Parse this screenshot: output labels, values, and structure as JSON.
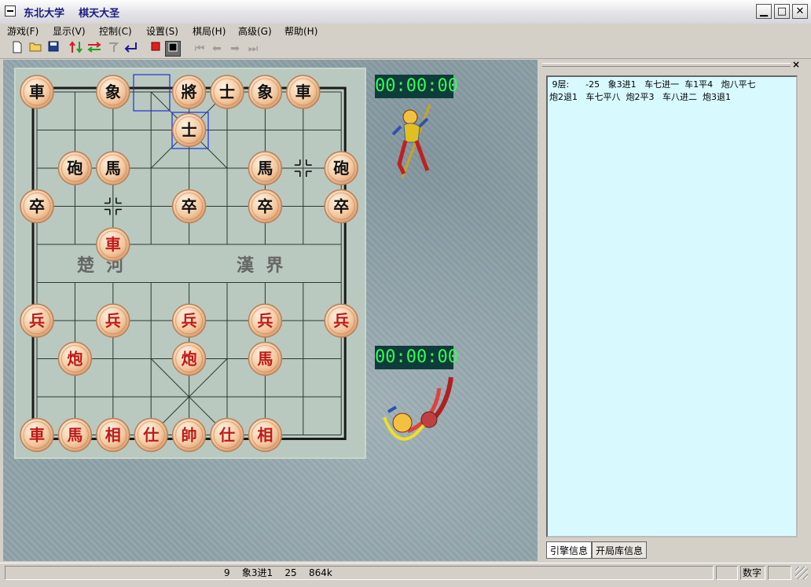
{
  "window": {
    "title": "东北大学    棋天大圣"
  },
  "menu": [
    "游戏(F)",
    "显示(V)",
    "控制(C)",
    "设置(S)",
    "棋局(H)",
    "高级(G)",
    "帮助(H)"
  ],
  "board": {
    "river_left": "楚  河",
    "river_right": "漢  界",
    "black_pieces": [
      {
        "label": "車",
        "col": 0,
        "row": 0
      },
      {
        "label": "象",
        "col": 2,
        "row": 0
      },
      {
        "label": "將",
        "col": 4,
        "row": 0
      },
      {
        "label": "士",
        "col": 5,
        "row": 0
      },
      {
        "label": "象",
        "col": 6,
        "row": 0
      },
      {
        "label": "車",
        "col": 7,
        "row": 0
      },
      {
        "label": "士",
        "col": 4,
        "row": 1
      },
      {
        "label": "砲",
        "col": 1,
        "row": 2
      },
      {
        "label": "馬",
        "col": 2,
        "row": 2
      },
      {
        "label": "馬",
        "col": 6,
        "row": 2
      },
      {
        "label": "砲",
        "col": 8,
        "row": 2
      },
      {
        "label": "卒",
        "col": 0,
        "row": 3
      },
      {
        "label": "卒",
        "col": 4,
        "row": 3
      },
      {
        "label": "卒",
        "col": 6,
        "row": 3
      },
      {
        "label": "卒",
        "col": 8,
        "row": 3
      }
    ],
    "red_pieces": [
      {
        "label": "車",
        "col": 2,
        "row": 4
      },
      {
        "label": "兵",
        "col": 0,
        "row": 6
      },
      {
        "label": "兵",
        "col": 2,
        "row": 6
      },
      {
        "label": "兵",
        "col": 4,
        "row": 6
      },
      {
        "label": "兵",
        "col": 6,
        "row": 6
      },
      {
        "label": "兵",
        "col": 8,
        "row": 6
      },
      {
        "label": "炮",
        "col": 1,
        "row": 7
      },
      {
        "label": "炮",
        "col": 4,
        "row": 7
      },
      {
        "label": "馬",
        "col": 6,
        "row": 7
      },
      {
        "label": "車",
        "col": 0,
        "row": 9
      },
      {
        "label": "馬",
        "col": 1,
        "row": 9
      },
      {
        "label": "相",
        "col": 2,
        "row": 9
      },
      {
        "label": "仕",
        "col": 3,
        "row": 9
      },
      {
        "label": "帥",
        "col": 4,
        "row": 9
      },
      {
        "label": "仕",
        "col": 5,
        "row": 9
      },
      {
        "label": "相",
        "col": 6,
        "row": 9
      }
    ]
  },
  "clocks": {
    "top": "00:00:00",
    "bottom": "00:00:00"
  },
  "engine_info": {
    "line1": " 9层:      -25   象3进1   车七进一  车1平4   炮八平七",
    "line2": "炮2退1   车七平八  炮2平3   车八进二  炮3退1"
  },
  "tabs": {
    "engine": "引擎信息",
    "opening": "开局库信息"
  },
  "status": {
    "main": "9    象3进1    25    864k",
    "num": "数字"
  },
  "colors": {
    "board": "#b9c9bf",
    "clock_bg": "#0e3c3a",
    "clock_fg": "#33ff55",
    "info_bg": "#d8faff"
  }
}
